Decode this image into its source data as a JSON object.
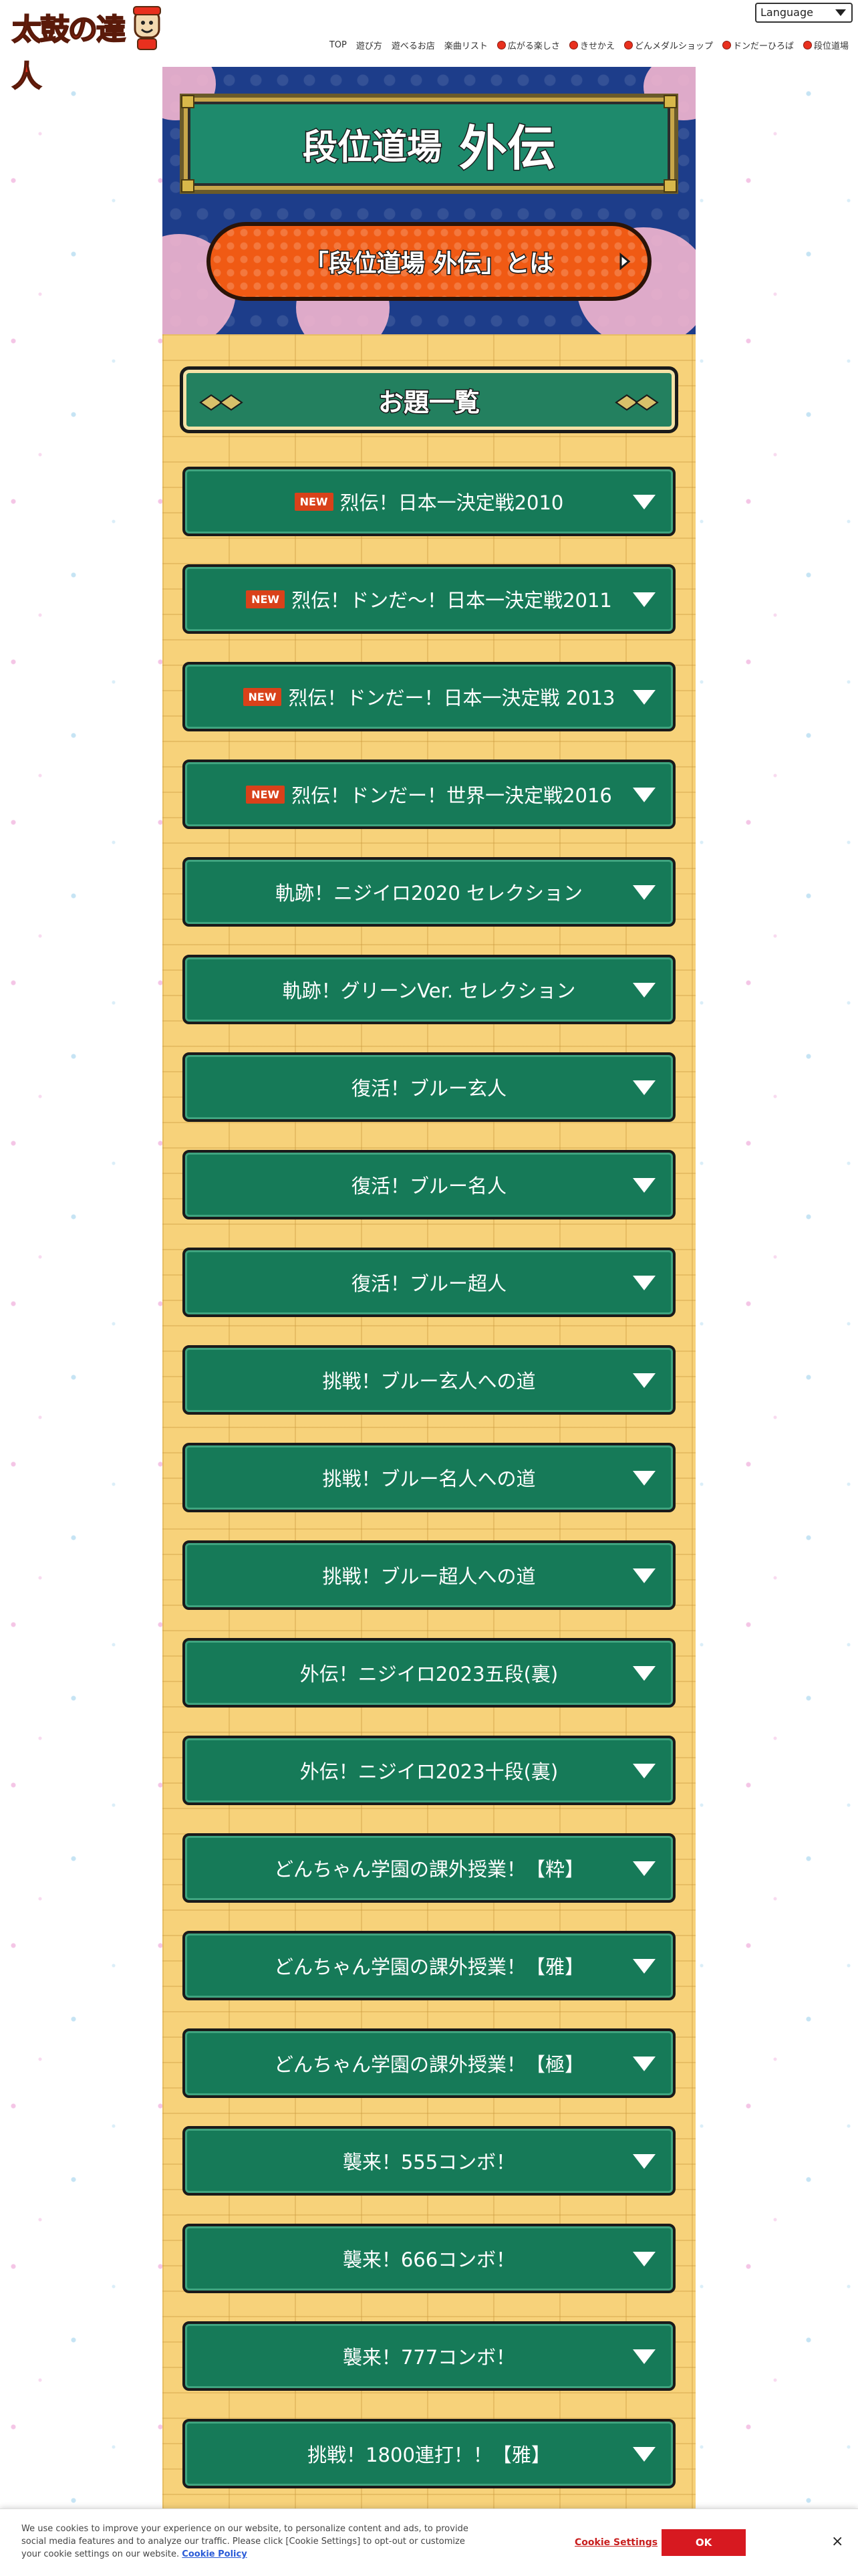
{
  "header": {
    "logo_text": "太鼓の達人",
    "language_label": "Language",
    "nav": [
      {
        "label": "TOP",
        "icon": ""
      },
      {
        "label": "遊び方",
        "icon": ""
      },
      {
        "label": "遊べるお店",
        "icon": ""
      },
      {
        "label": "楽曲リスト",
        "icon": ""
      },
      {
        "label": "広がる楽しさ",
        "icon": "drum-icon"
      },
      {
        "label": "きせかえ",
        "icon": "drum-icon"
      },
      {
        "label": "どんメダルショップ",
        "icon": "drum-icon"
      },
      {
        "label": "ドンだーひろば",
        "icon": "drum-icon"
      },
      {
        "label": "段位道場",
        "icon": "drum-icon"
      }
    ]
  },
  "hero": {
    "title_main": "段位道場",
    "title_sub": "外伝",
    "about_button": "「段位道場 外伝」とは"
  },
  "list": {
    "section_title": "お題一覧",
    "new_badge": "NEW",
    "items": [
      {
        "label": "烈伝！日本一決定戦2010",
        "is_new": true
      },
      {
        "label": "烈伝！ドンだ〜！日本一決定戦2011",
        "is_new": true
      },
      {
        "label": "烈伝！ドンだー！日本一決定戦 2013",
        "is_new": true
      },
      {
        "label": "烈伝！ドンだー！世界一決定戦2016",
        "is_new": true
      },
      {
        "label": "軌跡！ニジイロ2020 セレクション",
        "is_new": false
      },
      {
        "label": "軌跡！グリーンVer. セレクション",
        "is_new": false
      },
      {
        "label": "復活！ブルー玄人",
        "is_new": false
      },
      {
        "label": "復活！ブルー名人",
        "is_new": false
      },
      {
        "label": "復活！ブルー超人",
        "is_new": false
      },
      {
        "label": "挑戦！ブルー玄人への道",
        "is_new": false
      },
      {
        "label": "挑戦！ブルー名人への道",
        "is_new": false
      },
      {
        "label": "挑戦！ブルー超人への道",
        "is_new": false
      },
      {
        "label": "外伝！ニジイロ2023五段(裏)",
        "is_new": false
      },
      {
        "label": "外伝！ニジイロ2023十段(裏)",
        "is_new": false
      },
      {
        "label": "どんちゃん学園の課外授業！【粋】",
        "is_new": false
      },
      {
        "label": "どんちゃん学園の課外授業！【雅】",
        "is_new": false
      },
      {
        "label": "どんちゃん学園の課外授業！【極】",
        "is_new": false
      },
      {
        "label": "襲来！555コンボ！",
        "is_new": false
      },
      {
        "label": "襲来！666コンボ！",
        "is_new": false
      },
      {
        "label": "襲来！777コンボ！",
        "is_new": false
      },
      {
        "label": "挑戦！1800連打！！【雅】",
        "is_new": false
      }
    ]
  },
  "cookie": {
    "text": "We use cookies to improve your experience on our website, to personalize content and ads, to provide social media features and to analyze our traffic. Please click [Cookie Settings] to opt-out or customize your cookie settings on our website.",
    "policy_link": "Cookie Policy",
    "settings_button": "Cookie Settings",
    "ok_button": "OK",
    "close": "×"
  },
  "colors": {
    "item_green": "#167a58",
    "accent_orange": "#f05a14",
    "hero_blue": "#1d3d8a",
    "board_yellow": "#f7d27a",
    "new_red": "#d9411a"
  }
}
